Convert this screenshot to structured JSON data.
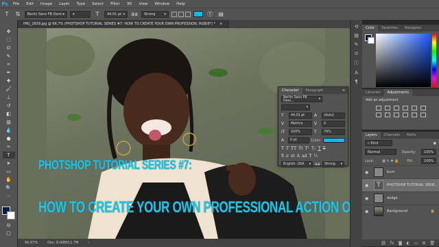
{
  "app": {
    "logo": "Ps"
  },
  "menu": [
    "File",
    "Edit",
    "Image",
    "Layer",
    "Type",
    "Select",
    "Filter",
    "3D",
    "View",
    "Window",
    "Help"
  ],
  "options": {
    "font_family": "Berlin Sans FB Demi",
    "font_size": "44.01 pt",
    "anti_alias": "Strong",
    "text_color": "#00bfe6"
  },
  "document": {
    "tab_title": "IMG_2839.jpg @ 66.7% (PHOTSHOP TUTORIAL SERIES #7:  HOW TO CREATE YOUR OWN PROFESSION, RGB/8*) *",
    "caption_line1": "PHOTSHOP TUTORIAL SERIES #7:",
    "caption_line2": "HOW TO CREATE YOUR OWN PROFESSIONAL ACTION ON PHOTSOHOP",
    "caption_color": "#1fc3e3"
  },
  "status": {
    "zoom": "66.67%",
    "doc_size": "Doc: 8.00M/11.7M"
  },
  "color_panel": {
    "tabs": [
      "Color",
      "Swatches",
      "Navigator"
    ],
    "foreground": "#0a1a4a",
    "background": "#ffffff"
  },
  "adjustments_panel": {
    "tabs": [
      "Libraries",
      "Adjustments"
    ],
    "title": "Add an adjustment"
  },
  "layers_panel": {
    "tabs": [
      "Layers",
      "Channels",
      "Paths"
    ],
    "kind": "Kind",
    "blend_mode": "Normal",
    "opacity_label": "Opacity:",
    "opacity": "100%",
    "lock_label": "Lock:",
    "fill_label": "Fill:",
    "fill": "100%",
    "layers": [
      {
        "name": "burn",
        "type": "fill"
      },
      {
        "name": "PHOTSHOP TUTORIAL SERIE...",
        "type": "text"
      },
      {
        "name": "dodge",
        "type": "fill"
      },
      {
        "name": "Background",
        "type": "photo"
      }
    ]
  },
  "character_panel": {
    "tabs": [
      "Character",
      "Paragraph"
    ],
    "font_family": "Berlin Sans FB Dem...",
    "font_size": "44.01 pt",
    "leading": "(Auto)",
    "kerning": "Metrics",
    "tracking": "0",
    "vertical_scale": "100%",
    "horizontal_scale": "79%",
    "baseline_shift": "0 pt",
    "color_label": "Color:",
    "language": "English: USA",
    "anti_alias": "Strong"
  }
}
